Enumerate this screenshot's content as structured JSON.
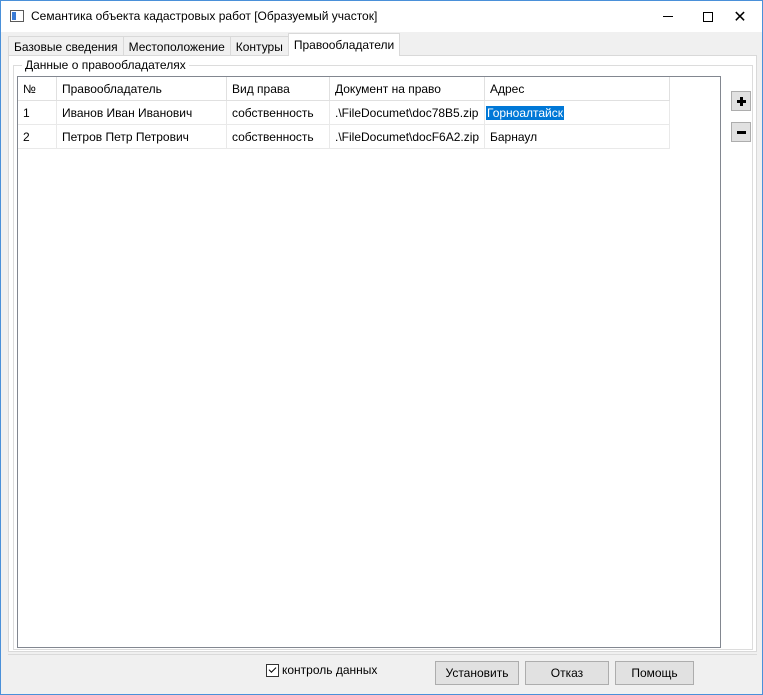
{
  "window": {
    "title": "Семантика объекта кадастровых работ [Образуемый участок]",
    "controls": {
      "minimize": "—",
      "maximize": "☐",
      "close": "✕"
    }
  },
  "tabs": [
    {
      "label": "Базовые сведения",
      "active": false
    },
    {
      "label": "Местоположение",
      "active": false
    },
    {
      "label": "Контуры",
      "active": false
    },
    {
      "label": "Правообладатели",
      "active": true
    }
  ],
  "group": {
    "label": "Данные о правообладателях"
  },
  "table": {
    "columns": [
      "№",
      "Правообладатель",
      "Вид права",
      "Документ на право",
      "Адрес"
    ],
    "rows": [
      {
        "num": "1",
        "owner": "Иванов Иван Иванович",
        "right": "собственность",
        "doc": ".\\FileDocumet\\doc78B5.zip",
        "address": "Горноалтайск",
        "address_selected": true
      },
      {
        "num": "2",
        "owner": "Петров Петр Петрович",
        "right": "собственность",
        "doc": ".\\FileDocumet\\docF6A2.zip",
        "address": "Барнаул",
        "address_selected": false
      }
    ]
  },
  "side_buttons": {
    "add_icon": "plus-icon",
    "remove_icon": "minus-icon"
  },
  "footer": {
    "checkbox_label": "контроль данных",
    "checkbox_checked": true,
    "set_label": "Установить",
    "cancel_label": "Отказ",
    "help_label": "Помощь"
  },
  "colors": {
    "selection": "#0078d7",
    "window_border": "#4a90d9",
    "button_bg": "#e1e1e1"
  }
}
